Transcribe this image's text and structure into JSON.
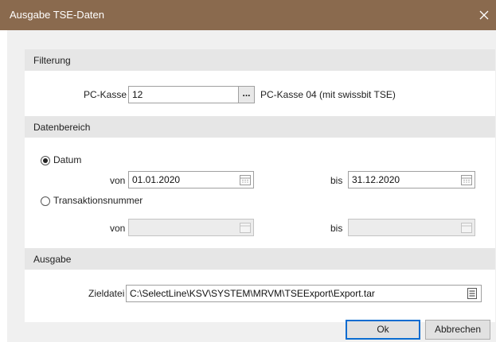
{
  "window": {
    "title": "Ausgabe TSE-Daten"
  },
  "filter": {
    "header": "Filterung",
    "pc_kasse_label": "PC-Kasse",
    "pc_kasse_value": "12",
    "browse_label": "...",
    "pc_kasse_desc": "PC-Kasse 04 (mit swissbit TSE)"
  },
  "datenbereich": {
    "header": "Datenbereich",
    "datum": {
      "label": "Datum",
      "selected": true,
      "von_label": "von",
      "von_value": "01.01.2020",
      "bis_label": "bis",
      "bis_value": "31.12.2020"
    },
    "transaktion": {
      "label": "Transaktionsnummer",
      "selected": false,
      "von_label": "von",
      "von_value": "",
      "bis_label": "bis",
      "bis_value": ""
    }
  },
  "ausgabe": {
    "header": "Ausgabe",
    "zieldatei_label": "Zieldatei",
    "zieldatei_value": "C:\\SelectLine\\KSV\\SYSTEM\\MRVM\\TSEExport\\Export.tar"
  },
  "buttons": {
    "ok": "Ok",
    "cancel": "Abbrechen"
  },
  "colors": {
    "titlebar": "#8a6a4e",
    "focus": "#0a6cd1",
    "section": "#e6e6e6"
  },
  "icons": [
    "close-icon",
    "calendar-icon",
    "file-picker-icon"
  ]
}
